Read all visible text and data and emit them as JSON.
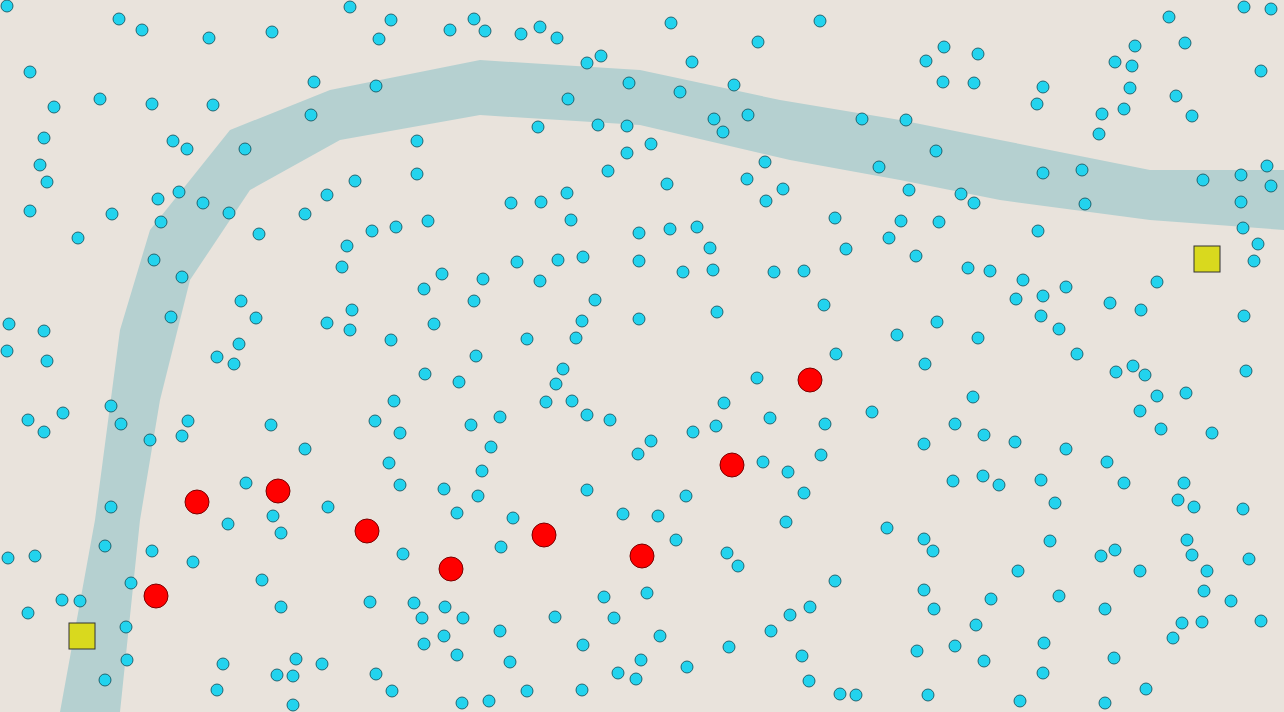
{
  "map": {
    "markers": [
      {
        "kind": "alert"
      },
      {
        "kind": "alert"
      },
      {
        "kind": "alert"
      },
      {
        "kind": "alert"
      },
      {
        "kind": "alert"
      },
      {
        "kind": "alert"
      },
      {
        "kind": "alert"
      },
      {
        "kind": "alert"
      },
      {
        "kind": "alert"
      },
      {
        "kind": "station"
      },
      {
        "kind": "station"
      }
    ]
  }
}
